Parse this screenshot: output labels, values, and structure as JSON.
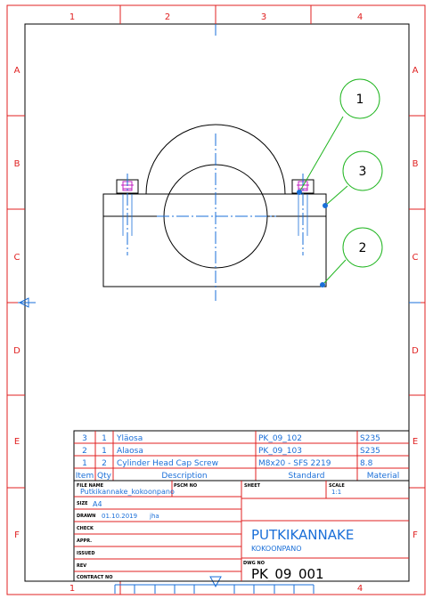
{
  "frame": {
    "col_labels": [
      "1",
      "2",
      "3",
      "4"
    ],
    "row_labels": [
      "A",
      "B",
      "C",
      "D",
      "E",
      "F"
    ]
  },
  "balloons": [
    "1",
    "3",
    "2"
  ],
  "bom": {
    "rows": [
      {
        "item": "3",
        "qty": "1",
        "description": "Yläosa",
        "standard": "PK_09_102",
        "material": "S235"
      },
      {
        "item": "2",
        "qty": "1",
        "description": "Alaosa",
        "standard": "PK_09_103",
        "material": "S235"
      },
      {
        "item": "1",
        "qty": "2",
        "description": "Cylinder Head Cap Screw",
        "standard": "M8x20 - SFS 2219",
        "material": "8.8"
      }
    ],
    "headers": {
      "item": "Item",
      "qty": "Qty",
      "description": "Description",
      "standard": "Standard",
      "material": "Material"
    }
  },
  "title_block": {
    "file_name_label": "FILE NAME",
    "file_name": "Putkikannake_kokoonpano",
    "pscm_label": "PSCM NO",
    "sheet_label": "SHEET",
    "scale_label": "SCALE",
    "scale": "1:1",
    "size_label": "SIZE",
    "size": "A4",
    "drawn_label": "DRAWN",
    "drawn_date": "01.10.2019",
    "drawn_by": "jha",
    "check_label": "CHECK",
    "appr_label": "APPR.",
    "issued_label": "ISSUED",
    "rev_label": "REV",
    "contract_label": "CONTRACT NO",
    "title": "PUTKIKANNAKE",
    "subtitle": "KOKOONPANO",
    "dwg_label": "DWG NO",
    "dwg_no": "PK_09_001"
  }
}
